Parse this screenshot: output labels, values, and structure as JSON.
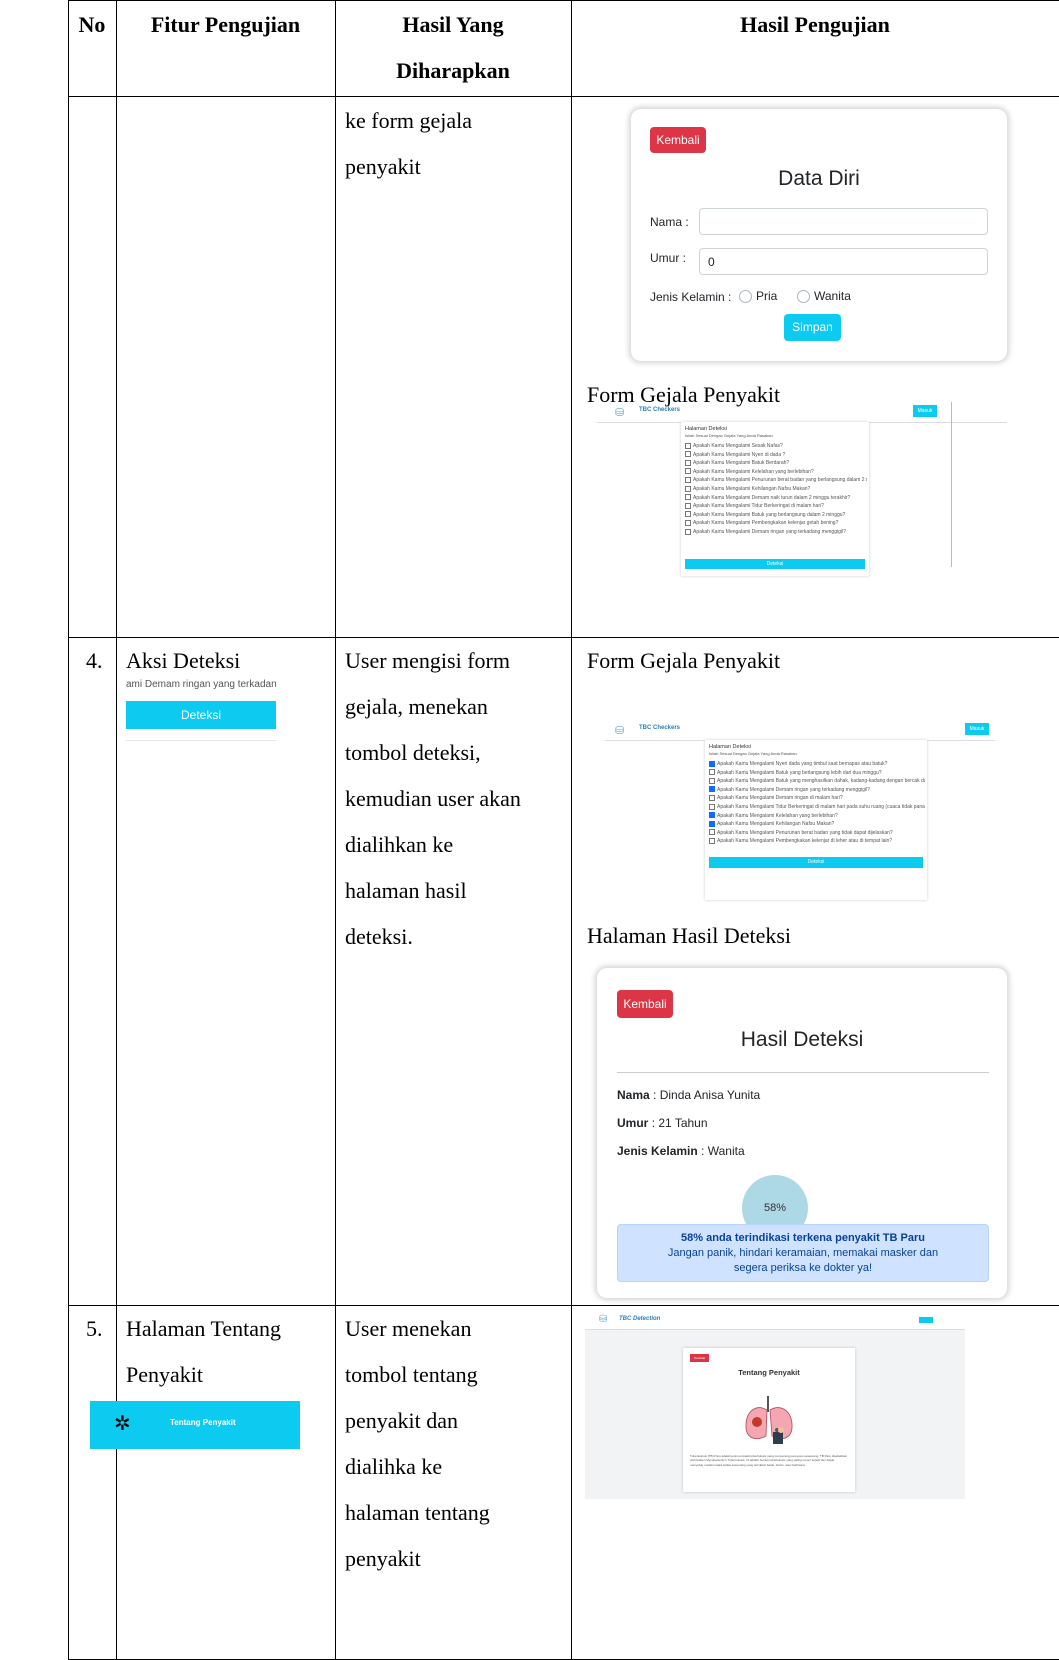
{
  "table": {
    "headers": {
      "no": "No",
      "fitur": "Fitur Pengujian",
      "harapan_line1": "Hasil Yang",
      "harapan_line2": "Diharapkan",
      "hasil": "Hasil Pengujian"
    },
    "row_cont": {
      "expected_lines": [
        "ke form gejala",
        "penyakit"
      ],
      "data_diri": {
        "back_label": "Kembali",
        "title": "Data Diri",
        "nama_label": "Nama :",
        "umur_label": "Umur :",
        "umur_value": "0",
        "jk_label": "Jenis Kelamin :",
        "opt_pria": "Pria",
        "opt_wanita": "Wanita",
        "save_label": "Simpan"
      },
      "caption": "Form Gejala Penyakit",
      "mini_form": {
        "brand": "TBC Checkers",
        "nav_btn": "Masuk",
        "heading": "Halaman Deteksi",
        "sub": "Isilah Sesuai Dengan Gejala Yang Anda Rasakan",
        "items": [
          "Apakah Kamu Mengalami Sesak Nafas?",
          "Apakah Kamu Mengalami Nyeri di dada ?",
          "Apakah Kamu Mengalami Batuk Berdarah?",
          "Apakah Kamu Mengalami Kelelahan yang berlebihan?",
          "Apakah Kamu Mengalami Penurunan berat badan yang berlangsung dalam 2 minggu?",
          "Apakah Kamu Mengalami Kehilangan Nafsu Makan?",
          "Apakah Kamu Mengalami Demam naik turun dalam 2 minggu terakhir?",
          "Apakah Kamu Mengalami Tidur Berkeringat di malam hari?",
          "Apakah Kamu Mengalami Batuk yang berlangsung dalam 2 minggu?",
          "Apakah Kamu Mengalami Pembengkakan kelenjar getah bening?",
          "Apakah Kamu Mengalami Demam ringan yang terkadang menggigil?"
        ],
        "button": "Deteksi"
      }
    },
    "row4": {
      "no": "4.",
      "feature": "Aksi Deteksi",
      "crop_text": "ami Demam ringan yang terkadang mengg",
      "crop_button": "Deteksi",
      "expected_lines": [
        "User mengisi form",
        "gejala, menekan",
        "tombol deteksi,",
        "kemudian user akan",
        "dialihkan ke",
        "halaman hasil",
        "deteksi."
      ],
      "caption1": "Form Gejala Penyakit",
      "mini_form": {
        "brand": "TBC Checkers",
        "nav_btn": "Masuk",
        "heading": "Halaman Deteksi",
        "sub": "Isilah Sesuai Dengan Gejala Yang Anda Rasakan",
        "items": [
          "Apakah Kamu Mengalami Nyeri dada yang timbul saat bernapas atau batuk?",
          "Apakah Kamu Mengalami Batuk yang berlangsung lebih dari dua minggu?",
          "Apakah Kamu Mengalami Batuk yang menghasilkan dahak, kadang-kadang dengan bercak darah?",
          "Apakah Kamu Mengalami Demam ringan yang terkadang menggigil?",
          "Apakah Kamu Mengalami Demam ringan di malam hari?",
          "Apakah Kamu Mengalami Tidur Berkeringat di malam hari pada suhu ruang (cuaca tidak panas)?",
          "Apakah Kamu Mengalami Kelelahan yang berlebihan?",
          "Apakah Kamu Mengalami Kehilangan Nafsu Makan?",
          "Apakah Kamu Mengalami Penurunan berat badan yang tidak dapat dijelaskan?",
          "Apakah Kamu Mengalami Pembengkakan kelenjar di leher atau di tempat lain?"
        ],
        "checked": [
          true,
          false,
          false,
          true,
          false,
          false,
          true,
          true,
          false,
          false
        ],
        "button": "Deteksi"
      },
      "caption2": "Halaman Hasil Deteksi",
      "result": {
        "back_label": "Kembali",
        "title": "Hasil Deteksi",
        "nama_key": "Nama",
        "nama_val": ": Dinda Anisa Yunita",
        "umur_key": "Umur",
        "umur_val": ": 21 Tahun",
        "jk_key": "Jenis Kelamin",
        "jk_val": ": Wanita",
        "percent": "58%",
        "alert_bold": "58% anda terindikasi terkena penyakit TB Paru",
        "alert_line2": "Jangan panik, hindari keramaian, memakai masker dan",
        "alert_line3": "segera periksa ke dokter ya!"
      }
    },
    "row5": {
      "no": "5.",
      "feature_lines": [
        "Halaman Tentang",
        "Penyakit"
      ],
      "crop_button": "Tentang Penyakit",
      "expected_lines": [
        "User menekan",
        "tombol tentang",
        "penyakit dan",
        "dialihka ke",
        "halaman tentang",
        "penyakit"
      ],
      "about": {
        "brand": "TBC Detection",
        "back_label": "Kembali",
        "title": "Tentang Penyakit",
        "body": "Tuberkulosis (TB) Paru adalah jenis penyakit tuberkulosis yang menyerang paru-paru seseorang. TB Paru disebabkan oleh bakteri Mycobacterium Tuberculosis, ini adalah bentuk tuberkulosis yang paling umum terjadi dan dapat menyebar melalui udara ketika seseorang yang terinfeksi batuk, bersin, atau berbicara."
      }
    }
  },
  "colors": {
    "red": "#dc3545",
    "cyan": "#0dcaf0",
    "alert_bg": "#cfe2ff",
    "alert_text": "#084298",
    "circle": "#add8e6"
  }
}
